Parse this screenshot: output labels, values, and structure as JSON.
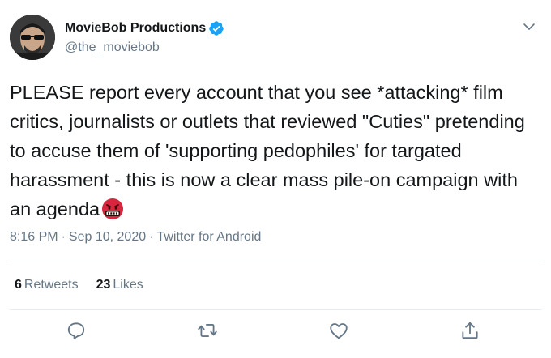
{
  "tweet": {
    "display_name": "MovieBob Productions",
    "handle": "@the_moviebob",
    "text": "PLEASE report every account that you see *attacking* film critics, journalists or outlets that reviewed \"Cuties\" pretending to accuse them of 'supporting pedophiles' for targated harassment - this is now a clear mass pile-on campaign with an agenda",
    "emoji": "face-with-symbols-on-mouth-icon",
    "time": "8:16 PM",
    "date": "Sep 10, 2020",
    "source": "Twitter for Android",
    "separator": "·"
  },
  "stats": {
    "retweets_count": "6",
    "retweets_label": "Retweets",
    "likes_count": "23",
    "likes_label": "Likes"
  },
  "colors": {
    "text": "#14171a",
    "secondary": "#657786",
    "verified": "#1da1f2",
    "divider": "#e6ecf0",
    "emoji_red": "#d7263d"
  },
  "icons": {
    "verified": "verified-badge-icon",
    "caret": "chevron-down-icon",
    "reply": "reply-icon",
    "retweet": "retweet-icon",
    "like": "heart-icon",
    "share": "share-icon"
  }
}
